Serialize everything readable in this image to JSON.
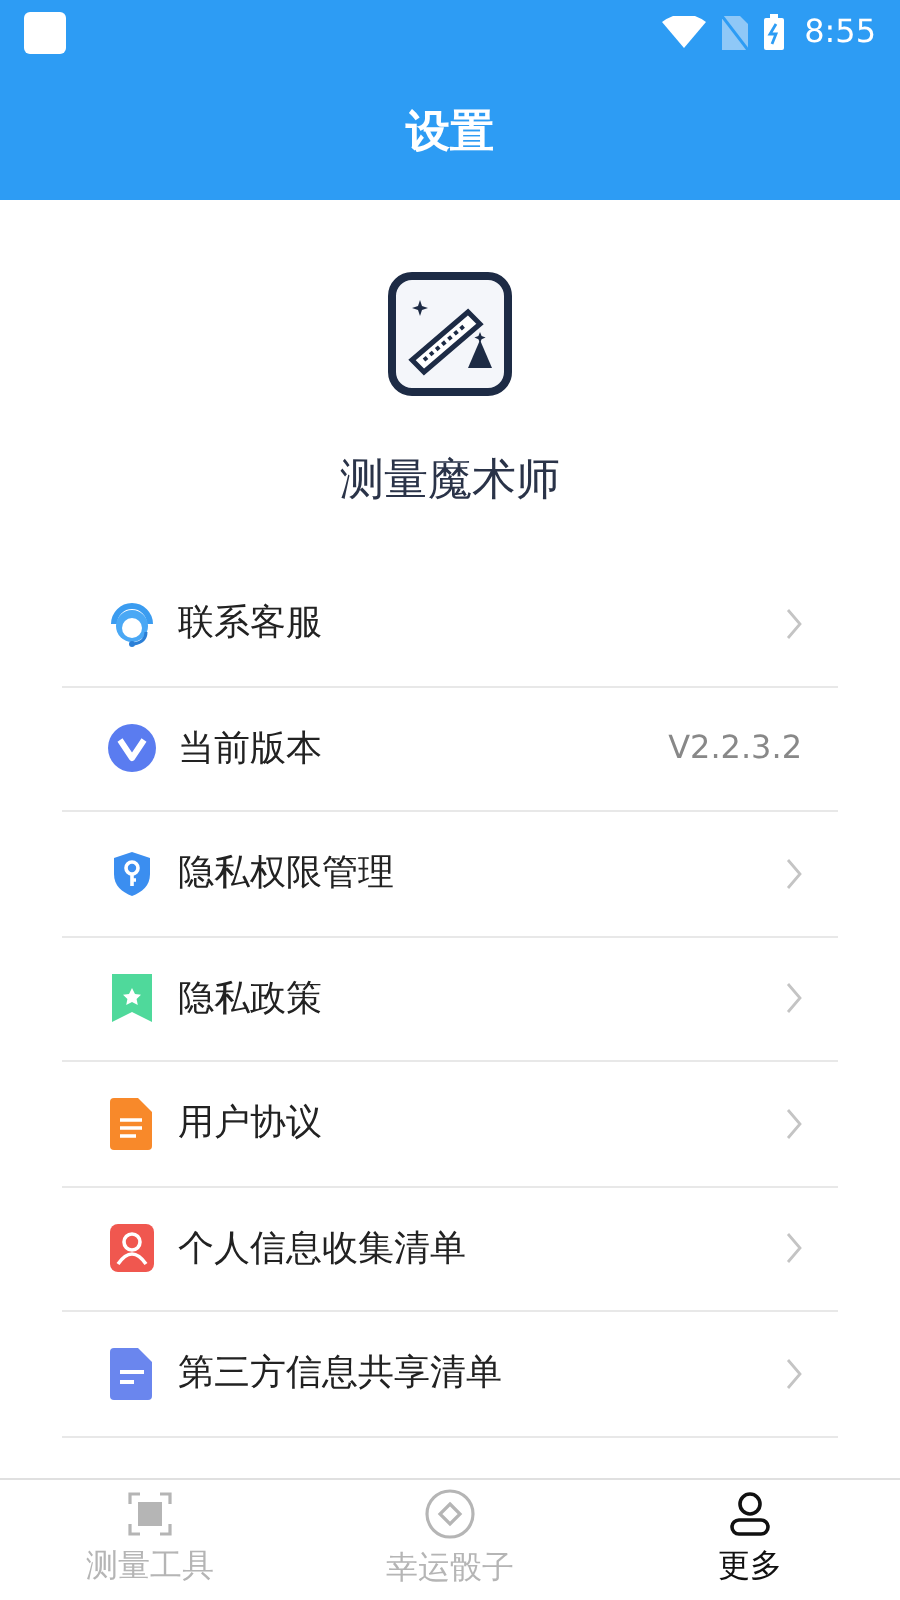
{
  "status_bar": {
    "time": "8:55"
  },
  "header": {
    "title": "设置"
  },
  "app": {
    "name": "测量魔术师"
  },
  "menu": [
    {
      "label": "联系客服",
      "kind": "link"
    },
    {
      "label": "当前版本",
      "kind": "value",
      "value": "V2.2.3.2"
    },
    {
      "label": "隐私权限管理",
      "kind": "link"
    },
    {
      "label": "隐私政策",
      "kind": "link"
    },
    {
      "label": "用户协议",
      "kind": "link"
    },
    {
      "label": "个人信息收集清单",
      "kind": "link"
    },
    {
      "label": "第三方信息共享清单",
      "kind": "link"
    }
  ],
  "tabs": [
    {
      "label": "测量工具",
      "selected": false
    },
    {
      "label": "幸运骰子",
      "selected": false
    },
    {
      "label": "更多",
      "selected": true
    }
  ]
}
